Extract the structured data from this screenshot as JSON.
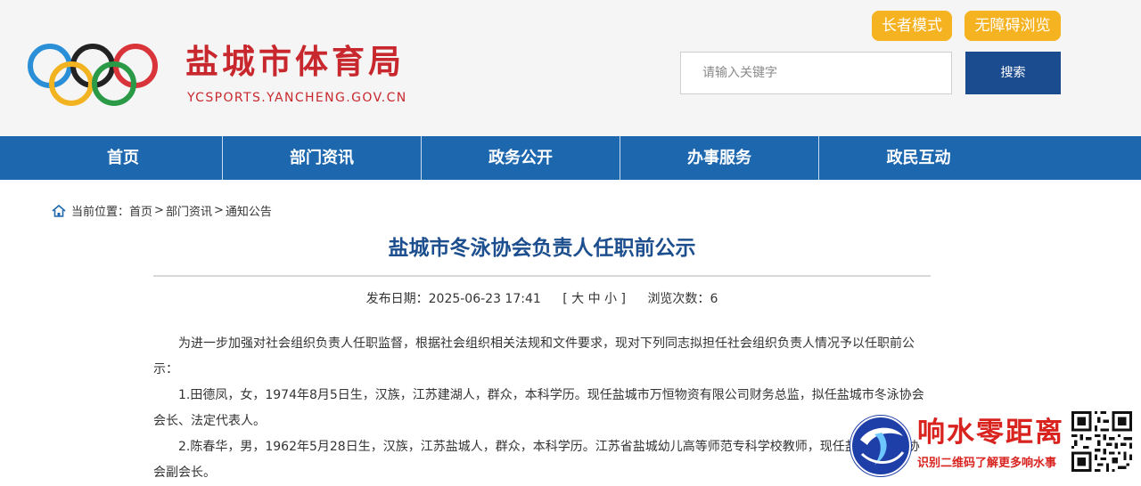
{
  "header": {
    "site_title": "盐城市体育局",
    "site_domain": "YCSPORTS.YANCHENG.GOV.CN",
    "elder_mode_label": "长者模式",
    "accessibility_label": "无障碍浏览",
    "search_placeholder": "请输入关键字",
    "search_button": "搜索"
  },
  "nav": {
    "items": [
      "首页",
      "部门资讯",
      "政务公开",
      "办事服务",
      "政民互动"
    ]
  },
  "breadcrumb": {
    "prefix": "当前位置：",
    "items": [
      "首页",
      "部门资讯",
      "通知公告"
    ],
    "separator": ">"
  },
  "article": {
    "title": "盐城市冬泳协会负责人任职前公示",
    "publish_label": "发布日期：",
    "publish_date": "2025-06-23 17:41",
    "font_size_control": "[ 大 中 小 ]",
    "views_label": "浏览次数：",
    "views": "6",
    "paragraphs": [
      "为进一步加强对社会组织负责人任职监督，根据社会组织相关法规和文件要求，现对下列同志拟担任社会组织负责人情况予以任职前公示：",
      "1.田德凤，女，1974年8月5日生，汉族，江苏建湖人，群众，本科学历。现任盐城市万恒物资有限公司财务总监，拟任盐城市冬泳协会会长、法定代表人。",
      "2.陈春华，男，1962年5月28日生，汉族，江苏盐城人，群众，本科学历。江苏省盐城幼儿高等师范专科学校教师，现任盐城市冬泳协会副会长。"
    ]
  },
  "watermark": {
    "title": "响水零距离",
    "subtitle": "识别二维码了解更多响水事"
  },
  "colors": {
    "brand_red": "#c8282d",
    "nav_blue": "#1d67ae",
    "search_blue": "#1b4c8f",
    "mode_button_orange": "#f5b221",
    "title_blue": "#1d4f8f"
  },
  "icons": {
    "logo": "olympic-rings-icon",
    "breadcrumb": "home-icon",
    "watermark_logo": "xiangshui-globe-logo",
    "watermark_qr": "qr-code-icon"
  }
}
